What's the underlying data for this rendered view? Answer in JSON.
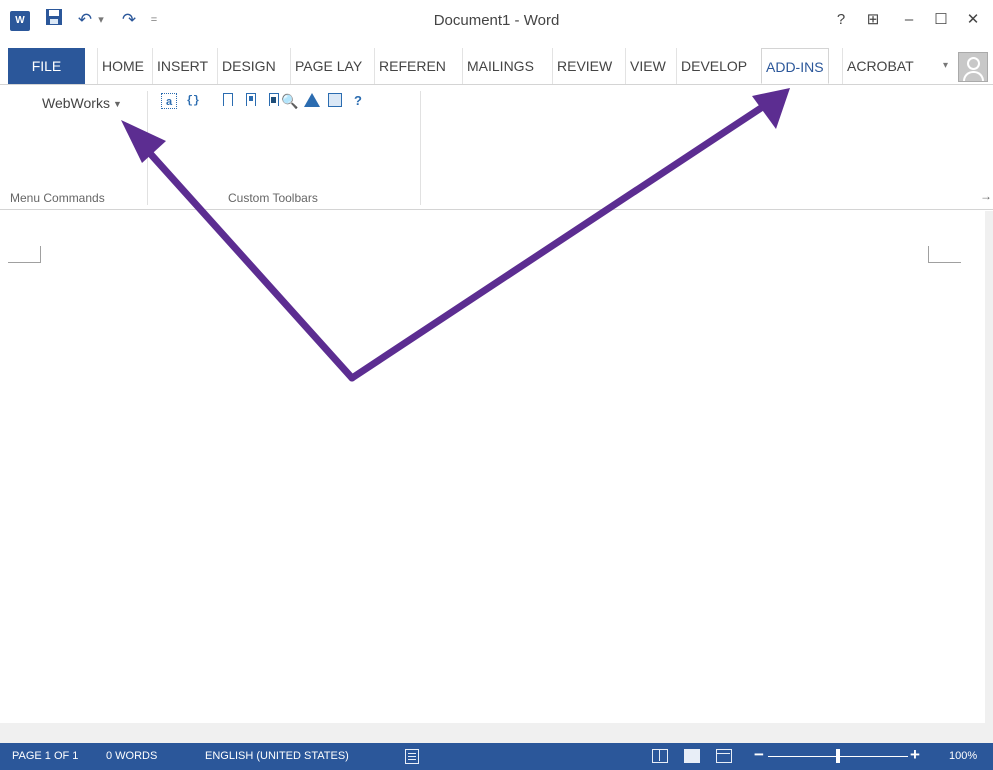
{
  "titlebar": {
    "app_icon": "word-app-icon",
    "title": "Document1 - Word",
    "help": "?",
    "ribbon_display": "⊞",
    "minimize": "–",
    "maximize": "☐",
    "close": "✕",
    "qat": {
      "save_icon": "save-icon",
      "undo": "↶",
      "redo": "↷",
      "customize": "="
    }
  },
  "tabs": {
    "file": "FILE",
    "items": [
      "HOME",
      "INSERT",
      "DESIGN",
      "PAGE LAY",
      "REFEREN",
      "MAILINGS",
      "REVIEW",
      "VIEW",
      "DEVELOP",
      "ADD-INS",
      "ACROBAT"
    ],
    "active": "ADD-INS",
    "more": "▾"
  },
  "ribbon": {
    "webworks_label": "WebWorks",
    "menu_group_label": "Menu Commands",
    "toolbar_group_label": "Custom Toolbars",
    "pin": "→"
  },
  "statusbar": {
    "page": "PAGE 1 OF 1",
    "words": "0 WORDS",
    "language": "ENGLISH (UNITED STATES)",
    "zoom": "100%",
    "zoom_percent": 100
  },
  "colors": {
    "word_blue": "#2b579a",
    "arrow_purple": "#5c2d91"
  }
}
